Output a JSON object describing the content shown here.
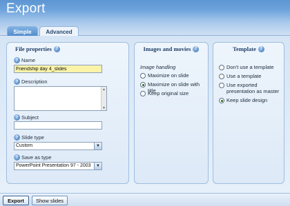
{
  "window": {
    "title": "Export"
  },
  "tabs": [
    {
      "label": "Simple"
    },
    {
      "label": "Advanced"
    }
  ],
  "file_properties": {
    "title": "File properties",
    "name": {
      "label": "Name",
      "value": "Friendship day 4_slides"
    },
    "description": {
      "label": "Description",
      "value": ""
    },
    "subject": {
      "label": "Subject",
      "value": ""
    },
    "slide_type": {
      "label": "Slide type",
      "selected": "Custom"
    },
    "save_as_type": {
      "label": "Save as type",
      "selected": "PowerPoint Presentation 97 - 2003"
    }
  },
  "images_movies": {
    "title": "Images and movies",
    "subhead": "Image handling",
    "options": [
      {
        "label": "Maximize on slide",
        "selected": false
      },
      {
        "label": "Maximize on slide with title",
        "selected": true
      },
      {
        "label": "Keep original size",
        "selected": false
      }
    ]
  },
  "template": {
    "title": "Template",
    "options": [
      {
        "label": "Don't use a template",
        "selected": false
      },
      {
        "label": "Use a template",
        "selected": false
      },
      {
        "label": "Use exported presentation as master",
        "selected": false
      },
      {
        "label": "Keep slide design",
        "selected": true
      }
    ]
  },
  "buttons": {
    "export": "Export",
    "show_slides": "Show slides"
  },
  "icons": {
    "help": "help-icon",
    "dropdown": "chevron-down-icon"
  },
  "colors": {
    "accent": "#5c95d2",
    "highlight_field": "#fbf3a8"
  }
}
